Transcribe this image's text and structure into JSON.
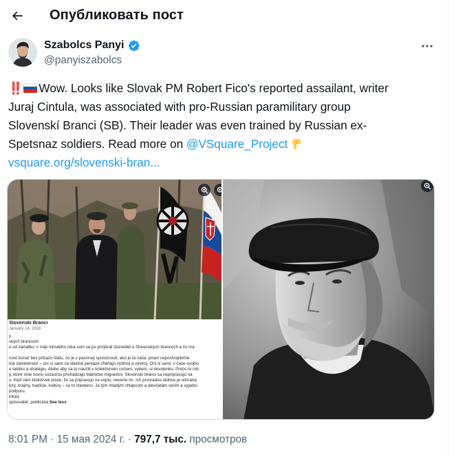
{
  "header": {
    "title": "Опубликовать пост"
  },
  "author": {
    "name": "Szabolcs Panyi",
    "handle": "@panyiszabolcs"
  },
  "tweet": {
    "lines": [
      "Wow. Looks like Slovak PM Robert Fico's reported assailant, writer",
      "Juraj Cintula, was associated with pro-Russian paramilitary group",
      "Slovenskí Branci (SB). Their leader was even trained by Russian ex-",
      "Spetsnaz soldiers. Read more on "
    ],
    "bang": "‼️",
    "mention": "@VSquare_Project",
    "url": "vsquare.org/slovenski-bran..."
  },
  "media": {
    "post": {
      "author": "Slovenski Branci",
      "date": "January 14, 2016 · ",
      "lines": [
        "y",
        "ských brancoch",
        "e od začiatku: v máji minulého roka som sa po prvýkrát dozvedel o Slovenských brancoch a čo ma",
        "",
        "nosť konať bez príkazu štátu, čo je v pasívnej spoločnosti, ako je tá naša, priam nepochopiteľné.",
        "tná zanietenosť – oni si sami za vlastné peniaze zháňajú výzbroj a výstroj. Oni si sami, v čase svojho",
        "u taktiku a stratégiu. Alebo aby sa to naučili v kolektívnom cvičení, vybení, si dovolenku. Prečo to rob",
        "y, ktoré sme tvoriu súčasťou prichádzajú štátnicke migrantov. Slovenskí branci sa nepripravujú na",
        "u. Keď vám ktokoľvek povie, že sa pripravujú na vojnu, neverte im. Ich prvoradou úlohou je ochrana",
        "lory, krajiny, tradície, kultúry – sú to vlastenci. Ja tým mladým chlapcom a dievčatám verím a vyjadru",
        "podporu.",
        "intula",
        "spisovateľ, publicista "
      ],
      "see_less": "See less"
    }
  },
  "meta": {
    "time": "8:01 PM",
    "sep": " · ",
    "date": "15 мая 2024 г.",
    "views_count": "797,7 тыс.",
    "views_label": "просмотров"
  },
  "colors": {
    "link": "#1d9bf0",
    "muted": "#536471",
    "verified": "#1d9bf0"
  }
}
